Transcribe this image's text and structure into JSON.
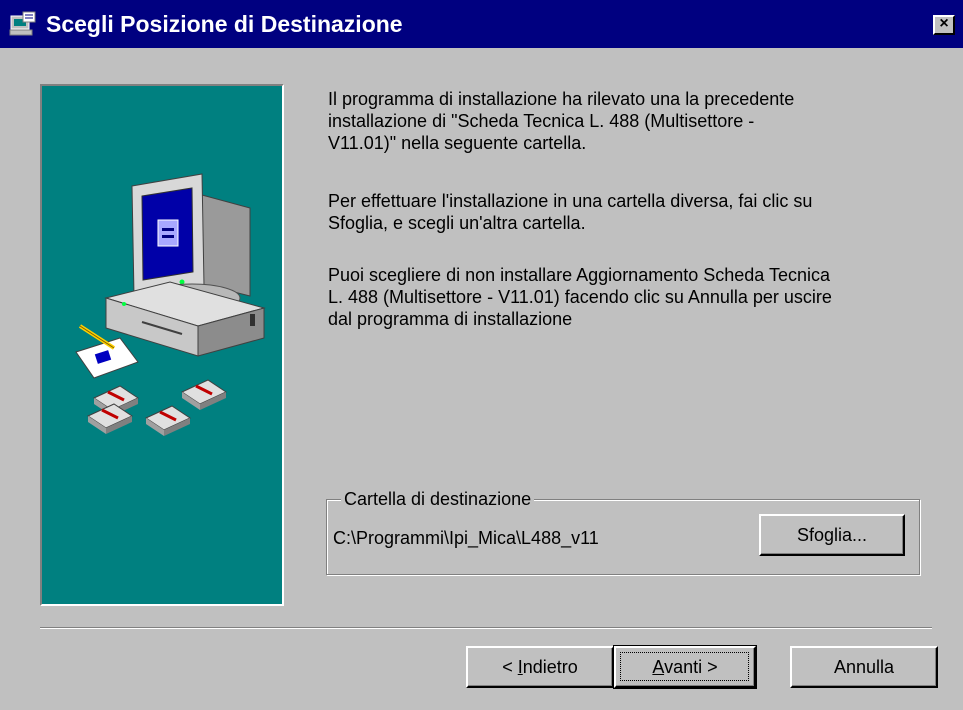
{
  "window": {
    "title": "Scegli Posizione di Destinazione",
    "close_symbol": "×",
    "title_icon": "setup-icon",
    "colors": {
      "titlebar": "#000080",
      "face": "#c0c0c0",
      "panel": "#008080"
    }
  },
  "side_panel": {
    "illustration": "computer-with-floppy-disks-illustration"
  },
  "content": {
    "paragraph1": "Il programma di installazione ha rilevato una la precedente\ninstallazione di  \"Scheda Tecnica L. 488 (Multisettore -\nV11.01)\" nella seguente cartella.",
    "paragraph2": "Per effettuare l'installazione in una cartella diversa, fai clic su\nSfoglia, e scegli un'altra cartella.",
    "paragraph3": "Puoi scegliere di non installare Aggiornamento Scheda Tecnica\nL. 488 (Multisettore - V11.01) facendo clic su Annulla per uscire\ndal programma di installazione"
  },
  "destination": {
    "group_label": "Cartella di destinazione",
    "path": "C:\\Programmi\\Ipi_Mica\\L488_v11",
    "browse_label": "Sfoglia..."
  },
  "buttons": {
    "back_prefix": "< ",
    "back_mnemonic": "I",
    "back_rest": "ndietro",
    "next_mnemonic": "A",
    "next_rest": "vanti >",
    "cancel_label": "Annulla"
  }
}
